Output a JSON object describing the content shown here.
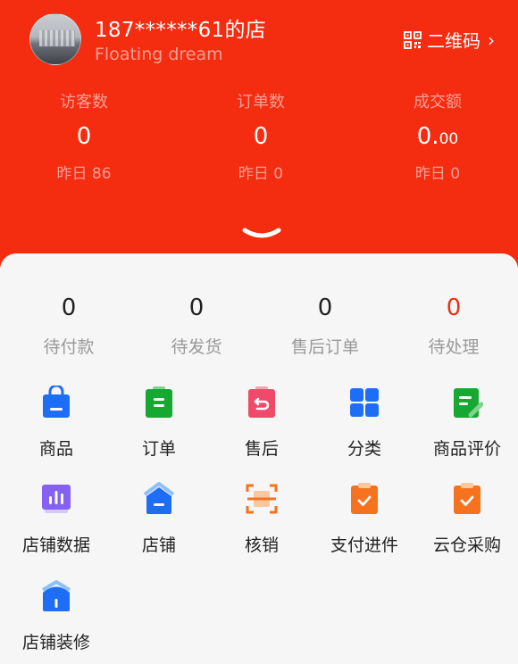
{
  "shop": {
    "name": "187******61的店",
    "subtitle": "Floating dream",
    "qr_label": "二维码",
    "qr_icon": "qr-code-icon"
  },
  "stats": [
    {
      "label": "访客数",
      "value": "0",
      "value_decimal": "",
      "yesterday": "昨日 86"
    },
    {
      "label": "订单数",
      "value": "0",
      "value_decimal": "",
      "yesterday": "昨日 0"
    },
    {
      "label": "成交额",
      "value": "0.",
      "value_decimal": "00",
      "yesterday": "昨日 0"
    }
  ],
  "counters": [
    {
      "value": "0",
      "label": "待付款"
    },
    {
      "value": "0",
      "label": "待发货"
    },
    {
      "value": "0",
      "label": "售后订单"
    },
    {
      "value": "0",
      "label": "待处理"
    }
  ],
  "tools": [
    {
      "label": "商品",
      "icon": "shopping-bag-icon"
    },
    {
      "label": "订单",
      "icon": "order-icon"
    },
    {
      "label": "售后",
      "icon": "return-icon"
    },
    {
      "label": "分类",
      "icon": "grid-icon"
    },
    {
      "label": "商品评价",
      "icon": "review-icon"
    },
    {
      "label": "店铺数据",
      "icon": "bar-chart-icon"
    },
    {
      "label": "店铺",
      "icon": "shop-icon"
    },
    {
      "label": "核销",
      "icon": "scan-icon"
    },
    {
      "label": "支付进件",
      "icon": "clipboard-check-icon"
    },
    {
      "label": "云仓采购",
      "icon": "clipboard-check-icon"
    },
    {
      "label": "店铺装修",
      "icon": "house-icon"
    }
  ],
  "colors": {
    "header_bg": "#f42c10",
    "accent_red": "#e83218",
    "panel_bg": "#f6f6f6"
  }
}
